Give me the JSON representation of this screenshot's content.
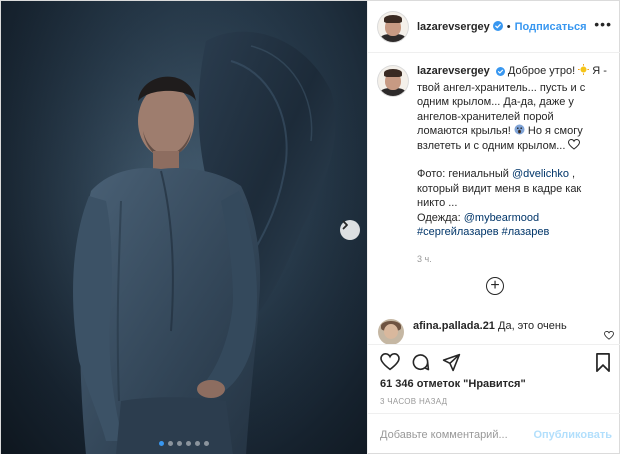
{
  "post": {
    "username": "lazarevsergey",
    "follow_label": "Подписаться",
    "separator": "•",
    "more_label": "•••",
    "caption": {
      "l1": "Доброе утро! ",
      "l1b": " Я -",
      "l2": "твой ангел-хранитель... пусть и с",
      "l3": "одним крылом... Да-да, даже у",
      "l4": "ангелов-хранителей порой",
      "l5": "ломаются крылья! ",
      "l5b": " Но я смогу",
      "l6": "взлететь и с одним крылом... ",
      "l7": "Фото: гениальный ",
      "mention1": "@dvelichko",
      "l7b": " ,",
      "l8": "который видит меня в кадре как",
      "l9": "никто ...",
      "l10": "Одежда: ",
      "mention2": "@mybearmood",
      "hashtag1": "#сергейлазарев",
      "hashtag2": "#лазарев"
    },
    "caption_time": "3 ч.",
    "comment": {
      "username": "afina.pallada.21",
      "text": "Да, это очень"
    },
    "likes_text": "61 346 отметок \"Нравится\"",
    "time_ago": "3 ЧАСОВ НАЗАД",
    "comment_placeholder": "Добавьте комментарий...",
    "publish_label": "Опубликовать",
    "carousel": {
      "slides": 6,
      "active_index": 0
    }
  },
  "colors": {
    "accent": "#3897f0",
    "publish_disabled": "#b2dffc",
    "link": "#003569"
  },
  "icons": [
    "verified-badge-icon",
    "chevron-right-icon",
    "heart-icon",
    "comment-icon",
    "share-icon",
    "bookmark-icon",
    "plus-circle-icon",
    "sun-emoji-icon",
    "scream-emoji-icon"
  ]
}
